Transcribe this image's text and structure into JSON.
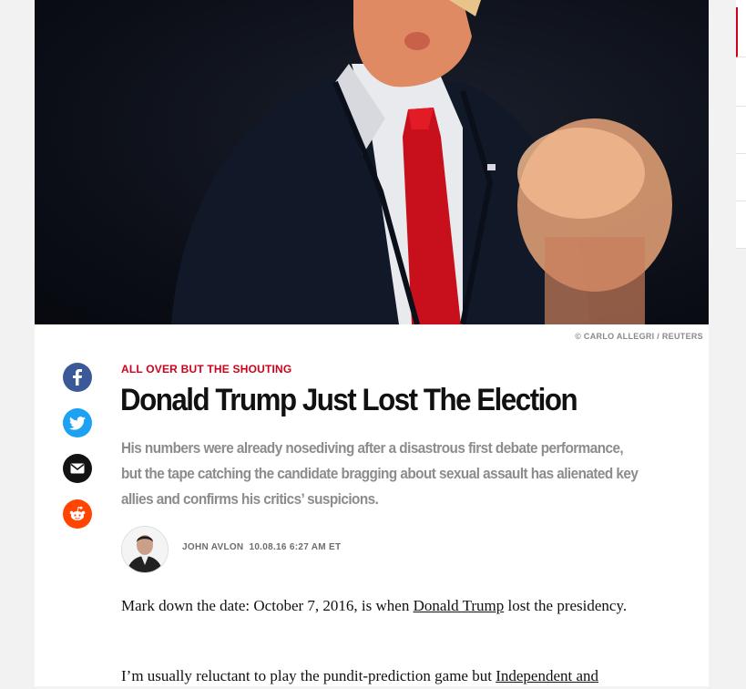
{
  "photo": {
    "credit": "© CARLO ALLEGRI / REUTERS"
  },
  "share": {
    "icons": [
      "facebook-icon",
      "twitter-icon",
      "email-icon",
      "reddit-icon"
    ]
  },
  "article": {
    "kicker": "ALL OVER BUT THE SHOUTING",
    "headline": "Donald Trump Just Lost The Election",
    "dek": "His numbers were already nosediving after a disastrous first debate performance, but the tape catching the candidate bragging about sexual assault has alienated key allies and confirms his critics’ suspicions.",
    "author": "JOHN AVLON",
    "date": "10.08.16 6:27 AM ET",
    "p1_before": "Mark down the date: October 7, 2016, is when ",
    "p1_link": "Donald Trump",
    "p1_after": " lost the presidency.",
    "p2_before": "I’m usually reluctant to play the pundit-prediction game but ",
    "p2_link": "Independent and"
  },
  "colors": {
    "accent": "#d0021b",
    "facebook": "#3b5998",
    "twitter": "#1da1f2",
    "email": "#121212",
    "reddit": "#ff4500"
  }
}
